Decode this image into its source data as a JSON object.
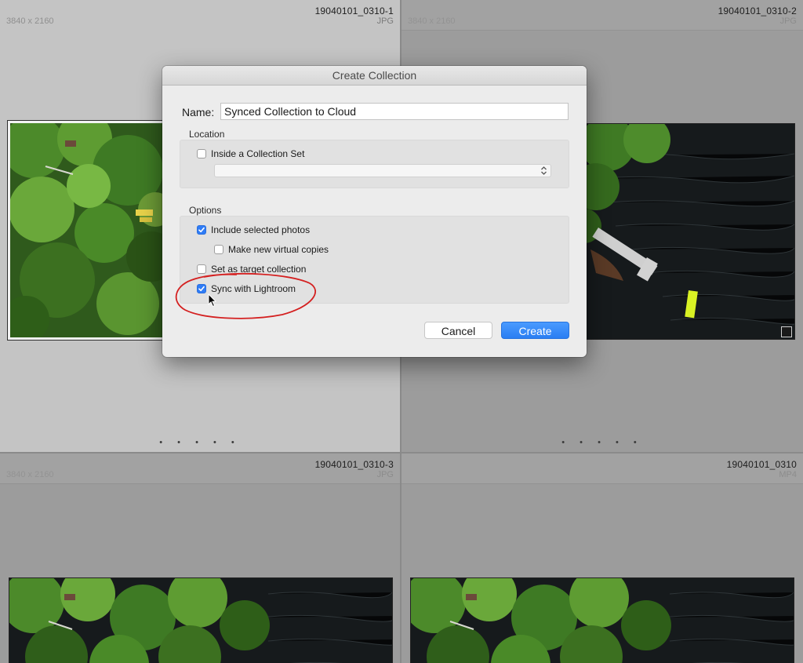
{
  "grid": [
    {
      "filename": "19040101_0310-1",
      "type": "JPG",
      "dimensions": "3840 x 2160",
      "dots": "• • • • •"
    },
    {
      "filename": "19040101_0310-2",
      "type": "JPG",
      "dimensions": "3840 x 2160",
      "dots": "• • • • •"
    },
    {
      "filename": "19040101_0310-3",
      "type": "JPG",
      "dimensions": "3840 x 2160"
    },
    {
      "filename": "19040101_0310",
      "type": "MP4",
      "dimensions": ""
    }
  ],
  "dialog": {
    "title": "Create Collection",
    "name_label": "Name:",
    "name_value": "Synced Collection to Cloud",
    "location_label": "Location",
    "inside_collection_set": {
      "label": "Inside a Collection Set",
      "checked": false
    },
    "collection_set_select": "",
    "options_label": "Options",
    "options": [
      {
        "label": "Include selected photos",
        "checked": true
      },
      {
        "label": "Make new virtual copies",
        "checked": false
      },
      {
        "label": "Set as target collection",
        "checked": false
      },
      {
        "label": "Sync with Lightroom",
        "checked": true
      }
    ],
    "cancel_label": "Cancel",
    "create_label": "Create"
  },
  "colors": {
    "accent": "#2f7cf6",
    "annotation": "#d42020"
  }
}
